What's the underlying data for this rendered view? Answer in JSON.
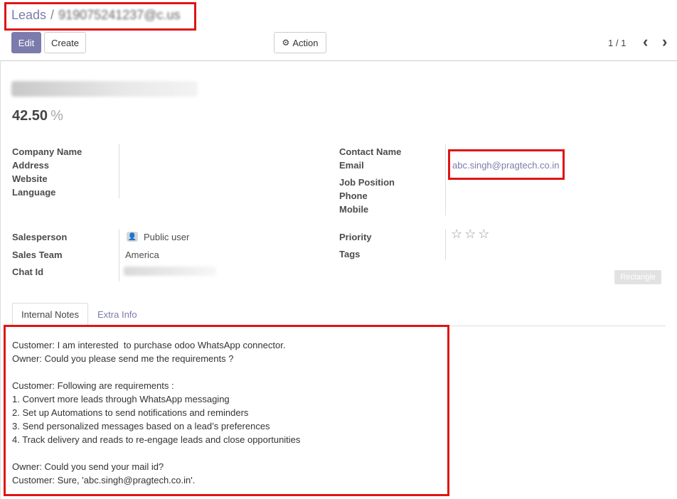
{
  "breadcrumb": {
    "root": "Leads",
    "separator": "/",
    "current": "919075241237@c.us"
  },
  "toolbar": {
    "edit_label": "Edit",
    "create_label": "Create",
    "action_label": "Action",
    "action_icon": "gear-icon"
  },
  "pager": {
    "value": "1 / 1",
    "prev_icon": "chevron-left-icon",
    "next_icon": "chevron-right-icon"
  },
  "record": {
    "name": "919075241237@c.us",
    "probability": "42.50",
    "probability_unit": "%"
  },
  "fields_left_1": [
    {
      "label": "Company Name",
      "value": ""
    },
    {
      "label": "Address",
      "value": ""
    },
    {
      "label": "Website",
      "value": ""
    },
    {
      "label": "Language",
      "value": ""
    }
  ],
  "fields_right_1": {
    "contact_name": "Contact Name",
    "email": "Email",
    "email_value": "abc.singh@pragtech.co.in",
    "job_position": "Job Position",
    "phone": "Phone",
    "mobile": "Mobile"
  },
  "fields_left_2": {
    "salesperson": "Salesperson",
    "salesperson_value": "Public user",
    "sales_team": "Sales Team",
    "sales_team_value": "America",
    "chat_id": "Chat Id"
  },
  "fields_right_2": {
    "priority": "Priority",
    "priority_stars": 0,
    "priority_max": 3,
    "tags": "Tags",
    "star_glyphs": "☆☆☆"
  },
  "badge": {
    "label": "Rectangle"
  },
  "tabs": [
    {
      "label": "Internal Notes",
      "active": true
    },
    {
      "label": "Extra Info",
      "active": false
    }
  ],
  "notes": [
    "Customer: I am interested  to purchase odoo WhatsApp connector.",
    "Owner: Could you please send me the requirements ?",
    "",
    "Customer: Following are requirements :",
    "1. Convert more leads through WhatsApp messaging",
    "2. Set up Automations to send notifications and reminders",
    "3. Send personalized messages based on a lead’s preferences",
    "4. Track delivery and reads to re-engage leads and close opportunities",
    "",
    "Owner: Could you send your mail id?",
    "Customer: Sure, 'abc.singh@pragtech.co.in'."
  ],
  "colors": {
    "accent": "#7c7bad",
    "highlight": "#e01414"
  }
}
